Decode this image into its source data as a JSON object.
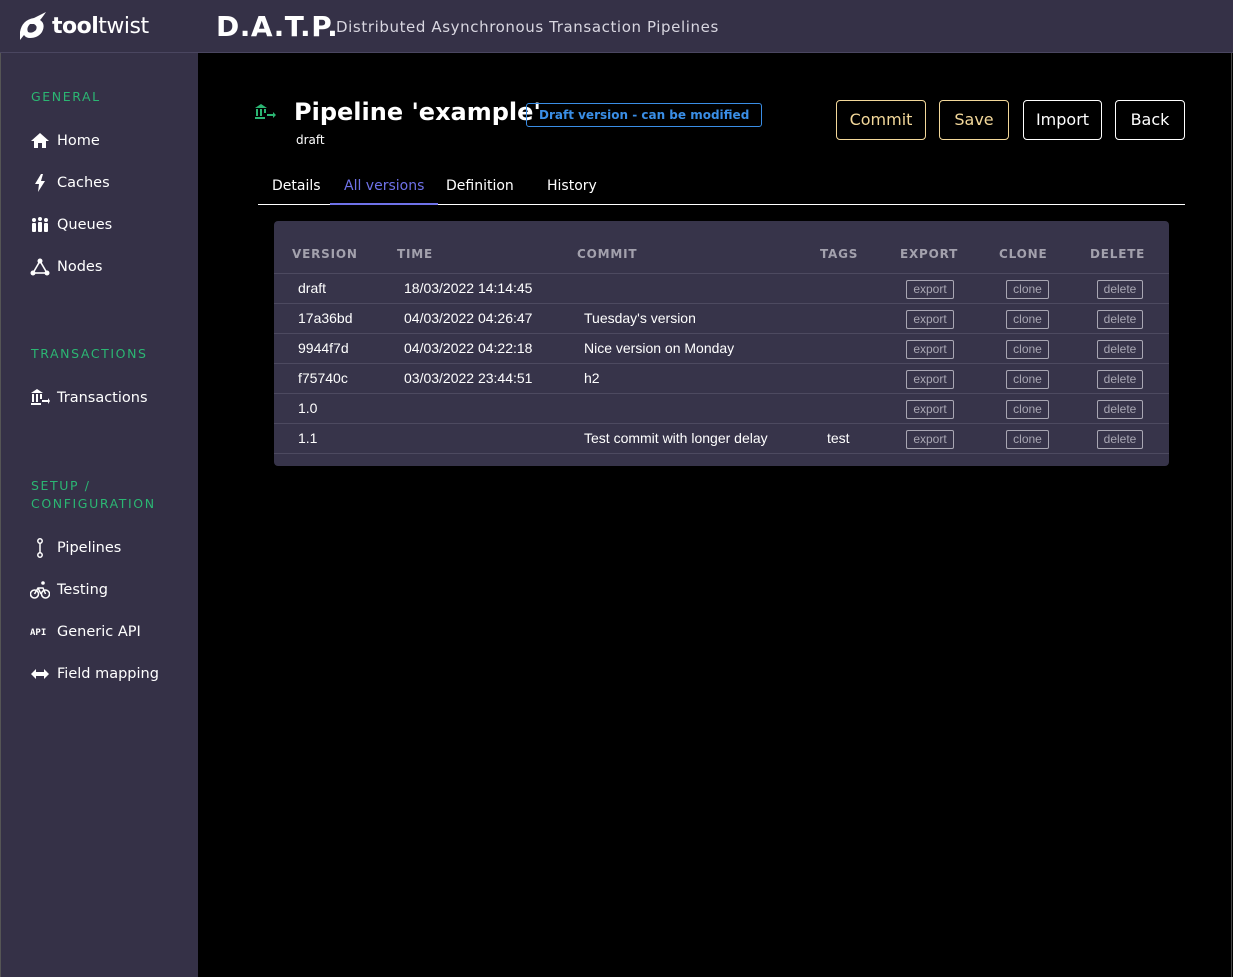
{
  "header": {
    "logo_bold": "tool",
    "logo_light": "twist",
    "app_title": "D.A.T.P.",
    "app_subtitle": "Distributed Asynchronous Transaction Pipelines"
  },
  "sidebar": {
    "sections": [
      {
        "title": "GENERAL"
      },
      {
        "title": "TRANSACTIONS"
      },
      {
        "title": "SETUP /"
      },
      {
        "title": "CONFIGURATION"
      }
    ],
    "items": [
      {
        "label": "Home",
        "icon": "home-icon"
      },
      {
        "label": "Caches",
        "icon": "lightning-icon"
      },
      {
        "label": "Queues",
        "icon": "people-queue-icon"
      },
      {
        "label": "Nodes",
        "icon": "nodes-icon"
      },
      {
        "label": "Transactions",
        "icon": "bank-transfer-icon"
      },
      {
        "label": "Pipelines",
        "icon": "pipeline-icon"
      },
      {
        "label": "Testing",
        "icon": "bicycle-icon"
      },
      {
        "label": "Generic API",
        "icon": "api-icon"
      },
      {
        "label": "Field mapping",
        "icon": "arrows-horizontal-icon"
      }
    ]
  },
  "page": {
    "title": "Pipeline 'example'",
    "subtitle": "draft",
    "badge": "Draft version - can be modified",
    "buttons": {
      "commit": "Commit",
      "save": "Save",
      "import": "Import",
      "back": "Back"
    },
    "tabs": [
      {
        "label": "Details",
        "active": false
      },
      {
        "label": "All versions",
        "active": true
      },
      {
        "label": "Definition",
        "active": false
      },
      {
        "label": "History",
        "active": false
      }
    ]
  },
  "versions_table": {
    "headers": {
      "version": "VERSION",
      "time": "TIME",
      "commit": "COMMIT",
      "tags": "TAGS",
      "export": "EXPORT",
      "clone": "CLONE",
      "delete": "DELETE"
    },
    "action_labels": {
      "export": "export",
      "clone": "clone",
      "delete": "delete"
    },
    "rows": [
      {
        "version": "draft",
        "time": "18/03/2022 14:14:45",
        "commit": "",
        "tags": ""
      },
      {
        "version": "17a36bd",
        "time": "04/03/2022 04:26:47",
        "commit": "Tuesday's version",
        "tags": ""
      },
      {
        "version": "9944f7d",
        "time": "04/03/2022 04:22:18",
        "commit": "Nice version on Monday",
        "tags": ""
      },
      {
        "version": "f75740c",
        "time": "03/03/2022 23:44:51",
        "commit": "h2",
        "tags": ""
      },
      {
        "version": "1.0",
        "time": "",
        "commit": "",
        "tags": ""
      },
      {
        "version": "1.1",
        "time": "",
        "commit": "Test commit with longer delay",
        "tags": "test"
      }
    ]
  },
  "colors": {
    "sidebar_bg": "#353147",
    "section_title": "#2bb673",
    "accent_tab": "#6f72e8",
    "badge_blue": "#3a8ee6",
    "commit_button": "#f3d89a",
    "table_bg": "#37344a"
  }
}
